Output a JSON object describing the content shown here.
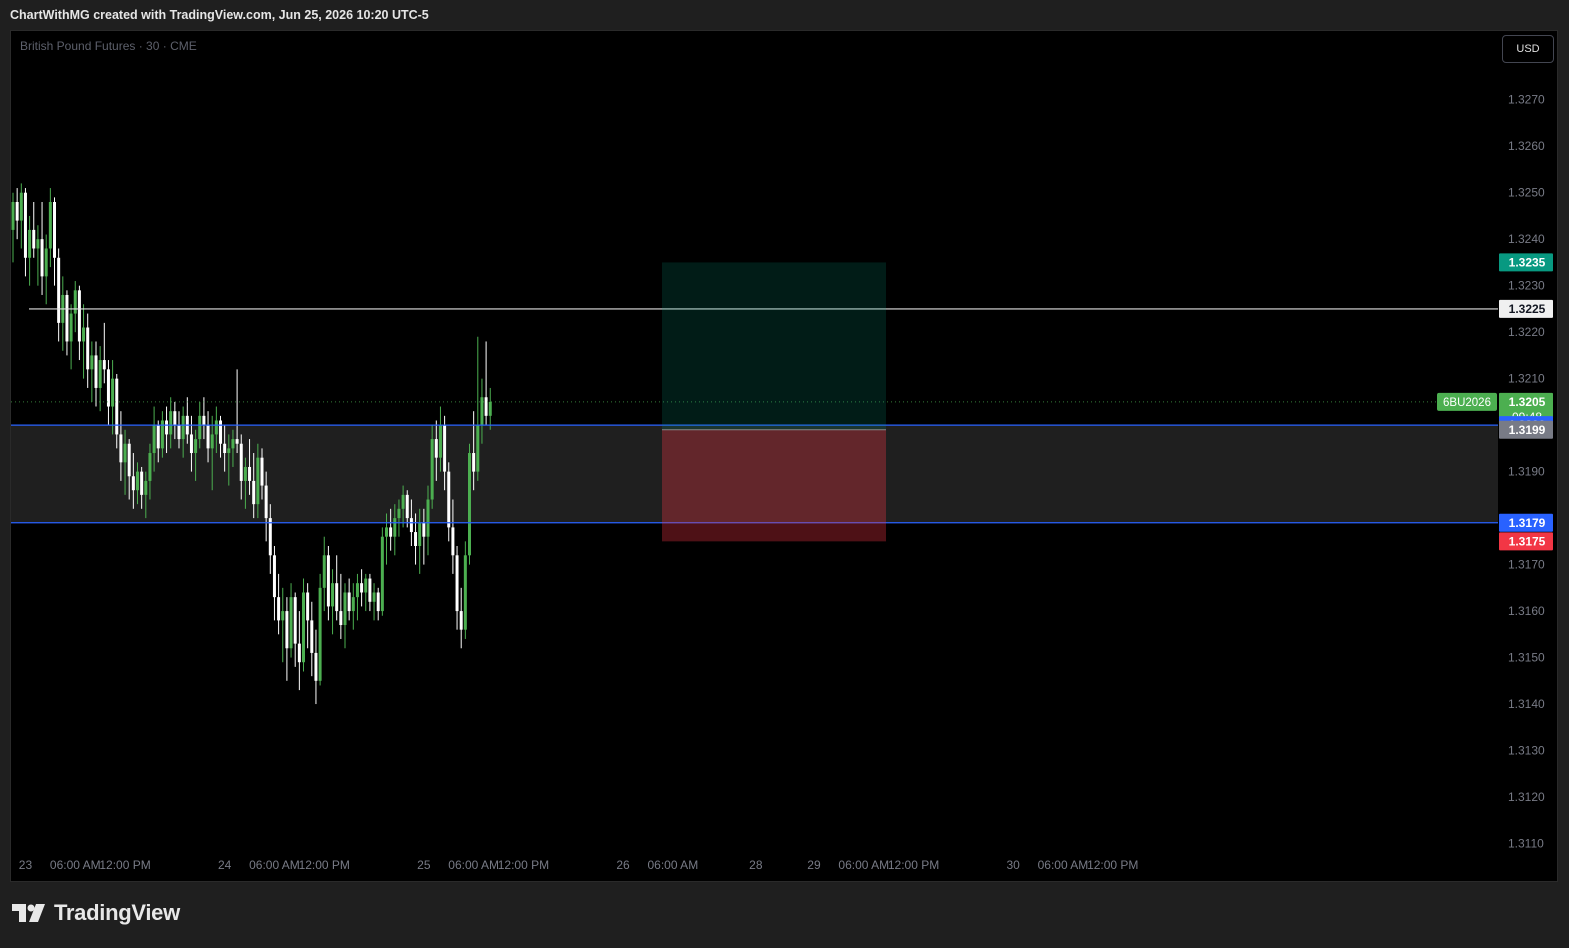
{
  "header": {
    "credit": "ChartWithMG created with TradingView.com, Jun 25, 2026 10:20 UTC-5"
  },
  "symbol": {
    "title": "British Pound Futures · 30 · CME",
    "ticker": "6BU2026"
  },
  "currency": "USD",
  "footer": {
    "brand": "TradingView"
  },
  "colors": {
    "bull": "#4caf50",
    "bear": "#ffffff",
    "target": "#089981",
    "stop": "#f23645",
    "zone_line": "#2962ff",
    "price_green": "#4caf50",
    "grid_text": "#787b86"
  },
  "chart_data": {
    "type": "candlestick",
    "ylim": [
      1.31,
      1.3285
    ],
    "y_ticks": [
      "1.3270",
      "1.3260",
      "1.3250",
      "1.3240",
      "1.3230",
      "1.3220",
      "1.3210",
      "1.3190",
      "1.3170",
      "1.3160",
      "1.3150",
      "1.3140",
      "1.3130",
      "1.3120",
      "1.3110"
    ],
    "x_ticks": [
      {
        "label": "23",
        "i": 3
      },
      {
        "label": "06:00 AM",
        "i": 15
      },
      {
        "label": "12:00 PM",
        "i": 27
      },
      {
        "label": "24",
        "i": 51
      },
      {
        "label": "06:00 AM",
        "i": 63
      },
      {
        "label": "12:00 PM",
        "i": 75
      },
      {
        "label": "25",
        "i": 99
      },
      {
        "label": "06:00 AM",
        "i": 111
      },
      {
        "label": "12:00 PM",
        "i": 123
      },
      {
        "label": "26",
        "i": 147
      },
      {
        "label": "06:00 AM",
        "i": 159
      },
      {
        "label": "28",
        "i": 179
      },
      {
        "label": "29",
        "i": 193
      },
      {
        "label": "06:00 AM",
        "i": 205
      },
      {
        "label": "12:00 PM",
        "i": 217
      },
      {
        "label": "30",
        "i": 241
      },
      {
        "label": "06:00 AM",
        "i": 253
      },
      {
        "label": "12:00 PM",
        "i": 265
      }
    ],
    "candles": [
      [
        1.3242,
        1.325,
        1.3235,
        1.3248
      ],
      [
        1.3248,
        1.3251,
        1.324,
        1.3244
      ],
      [
        1.3244,
        1.3252,
        1.3238,
        1.325
      ],
      [
        1.325,
        1.3251,
        1.3232,
        1.3236
      ],
      [
        1.3236,
        1.3245,
        1.323,
        1.3242
      ],
      [
        1.3242,
        1.3248,
        1.3236,
        1.3238
      ],
      [
        1.3238,
        1.3243,
        1.323,
        1.324
      ],
      [
        1.324,
        1.3248,
        1.3228,
        1.3232
      ],
      [
        1.3232,
        1.3241,
        1.3226,
        1.3238
      ],
      [
        1.3238,
        1.3251,
        1.3234,
        1.3248
      ],
      [
        1.3248,
        1.3249,
        1.323,
        1.3236
      ],
      [
        1.3236,
        1.3238,
        1.3218,
        1.3222
      ],
      [
        1.3222,
        1.3232,
        1.3216,
        1.3228
      ],
      [
        1.3228,
        1.3229,
        1.3215,
        1.3218
      ],
      [
        1.3218,
        1.3226,
        1.3212,
        1.3224
      ],
      [
        1.3224,
        1.3231,
        1.322,
        1.3229
      ],
      [
        1.3229,
        1.323,
        1.3214,
        1.3218
      ],
      [
        1.3218,
        1.3226,
        1.321,
        1.3221
      ],
      [
        1.3221,
        1.3224,
        1.3208,
        1.3212
      ],
      [
        1.3212,
        1.3218,
        1.3205,
        1.3215
      ],
      [
        1.3215,
        1.3218,
        1.3204,
        1.3208
      ],
      [
        1.3208,
        1.3217,
        1.3203,
        1.3214
      ],
      [
        1.3214,
        1.3222,
        1.3209,
        1.3212
      ],
      [
        1.3212,
        1.3214,
        1.32,
        1.3204
      ],
      [
        1.3204,
        1.3214,
        1.3198,
        1.321
      ],
      [
        1.321,
        1.3211,
        1.3195,
        1.3198
      ],
      [
        1.3198,
        1.3203,
        1.3188,
        1.3192
      ],
      [
        1.3192,
        1.3199,
        1.3185,
        1.3196
      ],
      [
        1.3196,
        1.3197,
        1.3184,
        1.3189
      ],
      [
        1.3189,
        1.3194,
        1.3182,
        1.3186
      ],
      [
        1.3186,
        1.3192,
        1.3183,
        1.319
      ],
      [
        1.319,
        1.3191,
        1.3182,
        1.3185
      ],
      [
        1.3185,
        1.319,
        1.318,
        1.3188
      ],
      [
        1.3188,
        1.3196,
        1.3184,
        1.3194
      ],
      [
        1.3194,
        1.3204,
        1.319,
        1.32
      ],
      [
        1.32,
        1.3201,
        1.3192,
        1.3195
      ],
      [
        1.3195,
        1.3203,
        1.3193,
        1.3201
      ],
      [
        1.3201,
        1.3204,
        1.3194,
        1.3198
      ],
      [
        1.3198,
        1.3206,
        1.3195,
        1.3203
      ],
      [
        1.3203,
        1.3205,
        1.3197,
        1.32
      ],
      [
        1.32,
        1.3203,
        1.3195,
        1.3197
      ],
      [
        1.3197,
        1.3204,
        1.3193,
        1.3202
      ],
      [
        1.3202,
        1.3206,
        1.3196,
        1.3198
      ],
      [
        1.3198,
        1.3202,
        1.319,
        1.3194
      ],
      [
        1.3194,
        1.3199,
        1.3188,
        1.3197
      ],
      [
        1.3197,
        1.3205,
        1.3195,
        1.3202
      ],
      [
        1.3202,
        1.3206,
        1.3197,
        1.32
      ],
      [
        1.32,
        1.3203,
        1.3192,
        1.3195
      ],
      [
        1.3195,
        1.3202,
        1.3186,
        1.3198
      ],
      [
        1.3198,
        1.3204,
        1.3194,
        1.3201
      ],
      [
        1.3201,
        1.3202,
        1.3193,
        1.3196
      ],
      [
        1.3196,
        1.32,
        1.319,
        1.3194
      ],
      [
        1.3194,
        1.3198,
        1.3187,
        1.3195
      ],
      [
        1.3195,
        1.3199,
        1.3191,
        1.3197
      ],
      [
        1.3197,
        1.3212,
        1.3194,
        1.3196
      ],
      [
        1.3196,
        1.3198,
        1.3184,
        1.3188
      ],
      [
        1.3188,
        1.3193,
        1.3182,
        1.3191
      ],
      [
        1.3191,
        1.3197,
        1.3185,
        1.3188
      ],
      [
        1.3188,
        1.3194,
        1.318,
        1.3183
      ],
      [
        1.3183,
        1.3196,
        1.318,
        1.3193
      ],
      [
        1.3193,
        1.3195,
        1.3184,
        1.3187
      ],
      [
        1.3187,
        1.319,
        1.3175,
        1.318
      ],
      [
        1.318,
        1.3183,
        1.3168,
        1.3172
      ],
      [
        1.3172,
        1.3174,
        1.3158,
        1.3163
      ],
      [
        1.3163,
        1.3168,
        1.3155,
        1.3158
      ],
      [
        1.3158,
        1.3165,
        1.3149,
        1.316
      ],
      [
        1.316,
        1.3163,
        1.3145,
        1.3152
      ],
      [
        1.3152,
        1.3166,
        1.315,
        1.3163
      ],
      [
        1.3163,
        1.3164,
        1.3148,
        1.3153
      ],
      [
        1.3153,
        1.316,
        1.3143,
        1.3149
      ],
      [
        1.3149,
        1.3167,
        1.3147,
        1.3164
      ],
      [
        1.3164,
        1.3166,
        1.3152,
        1.3158
      ],
      [
        1.3158,
        1.3162,
        1.3146,
        1.3151
      ],
      [
        1.3151,
        1.3156,
        1.314,
        1.3145
      ],
      [
        1.3145,
        1.3168,
        1.3144,
        1.3165
      ],
      [
        1.3165,
        1.3176,
        1.316,
        1.3172
      ],
      [
        1.3172,
        1.3174,
        1.3158,
        1.3161
      ],
      [
        1.3161,
        1.3169,
        1.3155,
        1.3166
      ],
      [
        1.3166,
        1.3172,
        1.3158,
        1.316
      ],
      [
        1.316,
        1.3168,
        1.3154,
        1.3157
      ],
      [
        1.3157,
        1.3166,
        1.3152,
        1.3164
      ],
      [
        1.3164,
        1.3167,
        1.3158,
        1.316
      ],
      [
        1.316,
        1.3166,
        1.3156,
        1.3163
      ],
      [
        1.3163,
        1.3168,
        1.3158,
        1.3166
      ],
      [
        1.3166,
        1.3169,
        1.3161,
        1.3164
      ],
      [
        1.3164,
        1.3168,
        1.316,
        1.3167
      ],
      [
        1.3167,
        1.3168,
        1.316,
        1.3162
      ],
      [
        1.3162,
        1.3166,
        1.3158,
        1.3164
      ],
      [
        1.3164,
        1.3165,
        1.3158,
        1.316
      ],
      [
        1.316,
        1.3178,
        1.3159,
        1.3176
      ],
      [
        1.3176,
        1.3181,
        1.317,
        1.3178
      ],
      [
        1.3178,
        1.3182,
        1.3173,
        1.3176
      ],
      [
        1.3176,
        1.3183,
        1.3172,
        1.318
      ],
      [
        1.318,
        1.3184,
        1.3176,
        1.3182
      ],
      [
        1.3182,
        1.3187,
        1.3178,
        1.3185
      ],
      [
        1.3185,
        1.3186,
        1.3178,
        1.318
      ],
      [
        1.318,
        1.3184,
        1.3174,
        1.3177
      ],
      [
        1.3177,
        1.3181,
        1.317,
        1.3174
      ],
      [
        1.3174,
        1.3182,
        1.3168,
        1.3179
      ],
      [
        1.3179,
        1.3182,
        1.317,
        1.3176
      ],
      [
        1.3176,
        1.3187,
        1.3172,
        1.3184
      ],
      [
        1.3184,
        1.32,
        1.3182,
        1.3197
      ],
      [
        1.3197,
        1.3201,
        1.3188,
        1.3193
      ],
      [
        1.3193,
        1.3204,
        1.319,
        1.32
      ],
      [
        1.32,
        1.3202,
        1.3186,
        1.319
      ],
      [
        1.319,
        1.3192,
        1.3175,
        1.3178
      ],
      [
        1.3178,
        1.3184,
        1.3168,
        1.3172
      ],
      [
        1.3172,
        1.3174,
        1.3156,
        1.316
      ],
      [
        1.316,
        1.3165,
        1.3152,
        1.3156
      ],
      [
        1.3156,
        1.3175,
        1.3154,
        1.3172
      ],
      [
        1.3172,
        1.3196,
        1.317,
        1.3194
      ],
      [
        1.3194,
        1.3203,
        1.3186,
        1.319
      ],
      [
        1.319,
        1.3219,
        1.3188,
        1.32
      ],
      [
        1.32,
        1.321,
        1.3196,
        1.3206
      ],
      [
        1.3206,
        1.3218,
        1.32,
        1.3202
      ],
      [
        1.3202,
        1.3208,
        1.3199,
        1.3205
      ]
    ],
    "levels": {
      "target": "1.3235",
      "resistance": "1.3225",
      "last": "1.3205",
      "countdown": "09:48",
      "zone_top": "1.3200",
      "entry": "1.3199",
      "zone_bottom": "1.3179",
      "stop": "1.3175"
    }
  }
}
